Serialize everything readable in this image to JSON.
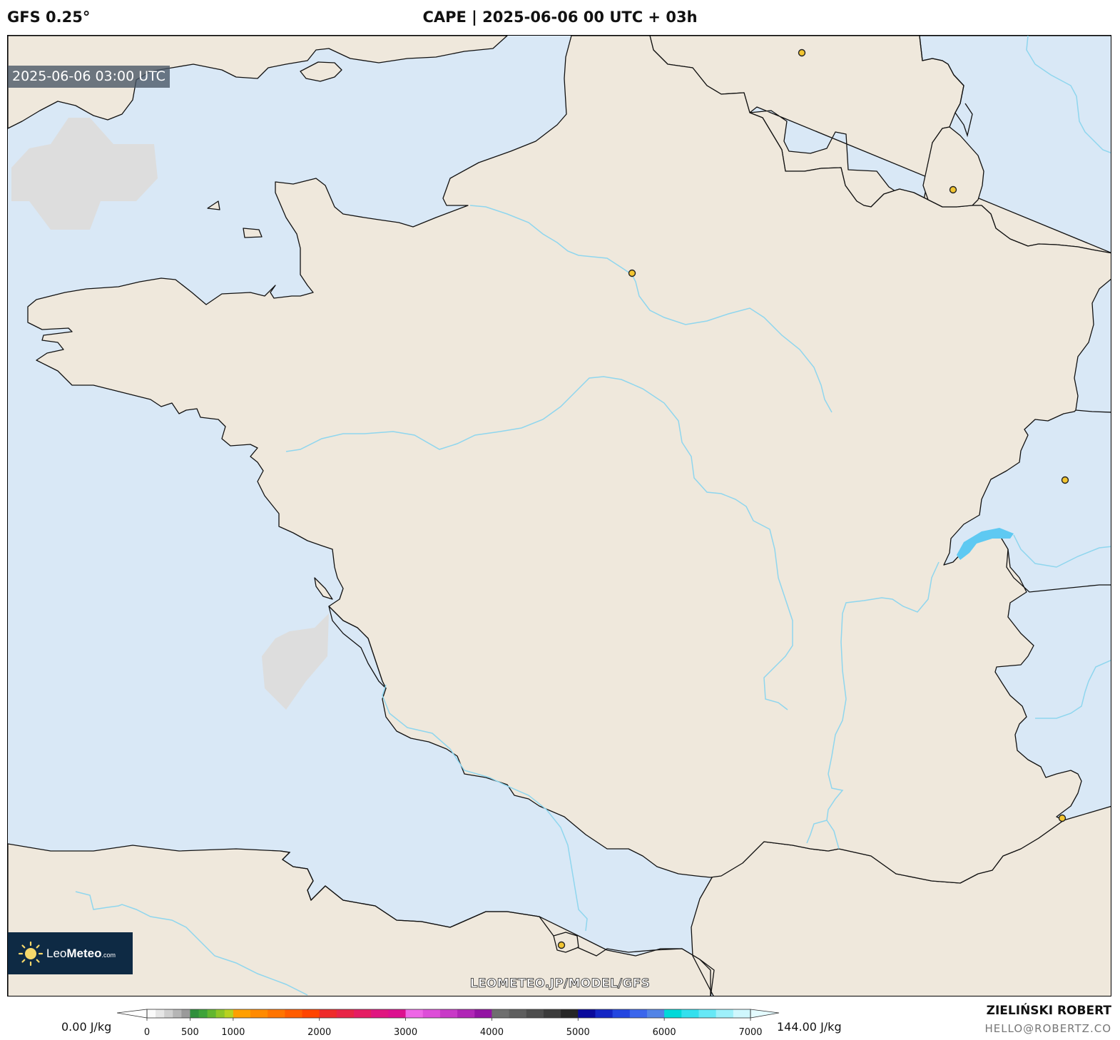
{
  "header": {
    "model": "GFS 0.25°",
    "title": "CAPE | 2025-06-06 00 UTC + 03h"
  },
  "map": {
    "valid_time": "2025-06-06 03:00 UTC",
    "watermark": "LEOMETEO.JP/MODEL/GFS",
    "logo": {
      "brand_light": "Leo",
      "brand_bold": "Meteo",
      "brand_suffix": ".com"
    },
    "colors": {
      "sea": "#d9e8f6",
      "land": "#efe8dc",
      "river": "#8fd6ee",
      "lake": "#5ec9f2",
      "no_data_patch": "#dddddd",
      "city_marker": "#f2c531"
    }
  },
  "colorbar": {
    "min_label": "0.00 J/kg",
    "max_label": "144.00 J/kg",
    "ticks": [
      "0",
      "500",
      "1000",
      "2000",
      "3000",
      "4000",
      "5000",
      "6000",
      "7000"
    ],
    "bands": [
      {
        "from": 0,
        "to": 100,
        "color": "#fafafa"
      },
      {
        "from": 100,
        "to": 200,
        "color": "#e6e6e6"
      },
      {
        "from": 200,
        "to": 300,
        "color": "#cfcfcf"
      },
      {
        "from": 300,
        "to": 400,
        "color": "#b5b5b5"
      },
      {
        "from": 400,
        "to": 500,
        "color": "#9a9a9a"
      },
      {
        "from": 500,
        "to": 600,
        "color": "#2f8f3c"
      },
      {
        "from": 600,
        "to": 700,
        "color": "#3ea33a"
      },
      {
        "from": 700,
        "to": 800,
        "color": "#62b630"
      },
      {
        "from": 800,
        "to": 900,
        "color": "#8ec628"
      },
      {
        "from": 900,
        "to": 1000,
        "color": "#b8d220"
      },
      {
        "from": 1000,
        "to": 1200,
        "color": "#ff9f00"
      },
      {
        "from": 1200,
        "to": 1400,
        "color": "#ff8a00"
      },
      {
        "from": 1400,
        "to": 1600,
        "color": "#ff7400"
      },
      {
        "from": 1600,
        "to": 1800,
        "color": "#ff5c00"
      },
      {
        "from": 1800,
        "to": 2000,
        "color": "#ff4400"
      },
      {
        "from": 2000,
        "to": 2200,
        "color": "#ee2b2b"
      },
      {
        "from": 2200,
        "to": 2400,
        "color": "#e82447"
      },
      {
        "from": 2400,
        "to": 2600,
        "color": "#e51d63"
      },
      {
        "from": 2600,
        "to": 2800,
        "color": "#e01680"
      },
      {
        "from": 2800,
        "to": 3000,
        "color": "#dc108f"
      },
      {
        "from": 3000,
        "to": 3200,
        "color": "#ee66e6"
      },
      {
        "from": 3200,
        "to": 3400,
        "color": "#dd4ed8"
      },
      {
        "from": 3400,
        "to": 3600,
        "color": "#c83ac7"
      },
      {
        "from": 3600,
        "to": 3800,
        "color": "#b026b6"
      },
      {
        "from": 3800,
        "to": 4000,
        "color": "#9313a3"
      },
      {
        "from": 4000,
        "to": 4200,
        "color": "#6e6e6e"
      },
      {
        "from": 4200,
        "to": 4400,
        "color": "#5e5e5e"
      },
      {
        "from": 4400,
        "to": 4600,
        "color": "#4d4d4d"
      },
      {
        "from": 4600,
        "to": 4800,
        "color": "#3b3b3b"
      },
      {
        "from": 4800,
        "to": 5000,
        "color": "#262626"
      },
      {
        "from": 5000,
        "to": 5200,
        "color": "#0a0a9c"
      },
      {
        "from": 5200,
        "to": 5400,
        "color": "#1426c4"
      },
      {
        "from": 5400,
        "to": 5600,
        "color": "#2346e0"
      },
      {
        "from": 5600,
        "to": 5800,
        "color": "#3b66ec"
      },
      {
        "from": 5800,
        "to": 6000,
        "color": "#5284e6"
      },
      {
        "from": 6000,
        "to": 6200,
        "color": "#00d9d9"
      },
      {
        "from": 6200,
        "to": 6400,
        "color": "#33e0ee"
      },
      {
        "from": 6400,
        "to": 6600,
        "color": "#66e8f6"
      },
      {
        "from": 6600,
        "to": 6800,
        "color": "#9ef0fa"
      },
      {
        "from": 6800,
        "to": 7000,
        "color": "#cff7fd"
      }
    ]
  },
  "footer": {
    "author": "ZIELIŃSKI ROBERT",
    "email": "HELLO@ROBERTZ.CO"
  }
}
